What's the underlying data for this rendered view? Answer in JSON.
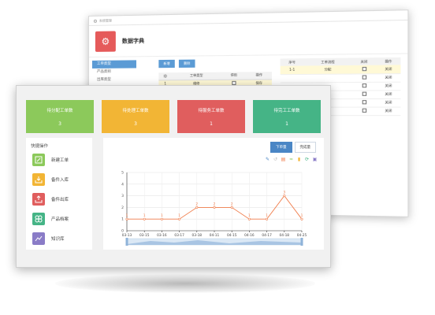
{
  "back_window": {
    "title_bar": "系统管理",
    "page_title": "数据字典",
    "sidebar_items": [
      "工单类型",
      "产品类别",
      "出库类型"
    ],
    "toolbar": {
      "add_label": "新增",
      "delete_label": "删除"
    },
    "left_table": {
      "columns": [
        "ID",
        "工单类型",
        "停用",
        "操作"
      ],
      "rows": [
        {
          "id": "1",
          "type": "维修",
          "action": "保存"
        }
      ]
    },
    "right_table": {
      "columns": [
        "序号",
        "工单流程",
        "关闭",
        "操作"
      ],
      "rows": [
        {
          "seq": "1-1",
          "flow": "分配",
          "action": "关闭"
        },
        {
          "seq": "",
          "flow": "",
          "action": "关闭"
        },
        {
          "seq": "",
          "flow": "",
          "action": "关闭"
        },
        {
          "seq": "",
          "flow": "",
          "action": "关闭"
        },
        {
          "seq": "",
          "flow": "",
          "action": "关闭"
        },
        {
          "seq": "",
          "flow": "",
          "action": "关闭"
        }
      ]
    }
  },
  "stats": [
    {
      "label": "待分配工单数",
      "value": "3",
      "color": "#8cc95b"
    },
    {
      "label": "待处理工单数",
      "value": "3",
      "color": "#f2b535"
    },
    {
      "label": "待服务工单数",
      "value": "1",
      "color": "#e05e5e"
    },
    {
      "label": "待完工工单数",
      "value": "1",
      "color": "#45b486"
    }
  ],
  "quick_ops": {
    "title": "快捷操作",
    "items": [
      {
        "label": "新建工单",
        "icon": "edit-icon",
        "color": "#8cc95b"
      },
      {
        "label": "备件入库",
        "icon": "inbox-in-icon",
        "color": "#f2b535"
      },
      {
        "label": "备件出库",
        "icon": "inbox-out-icon",
        "color": "#e05e5e"
      },
      {
        "label": "产品档案",
        "icon": "clover-icon",
        "color": "#45b486"
      },
      {
        "label": "知识库",
        "icon": "chart-image-icon",
        "color": "#8a7cc7"
      }
    ]
  },
  "chart_tabs": {
    "active": "下单量",
    "other": "完成量"
  },
  "chart_data": {
    "type": "line",
    "x": [
      "03-13",
      "03-15",
      "03-16",
      "03-17",
      "03-18",
      "04-11",
      "04-15",
      "04-16",
      "04-17",
      "04-18",
      "04-25"
    ],
    "values": [
      1,
      1,
      1,
      1,
      2,
      2,
      2,
      1,
      1,
      3,
      1
    ],
    "ylim": [
      0,
      5
    ],
    "yticks": [
      0,
      1,
      2,
      3,
      4,
      5
    ],
    "color": "#f07c4a"
  }
}
